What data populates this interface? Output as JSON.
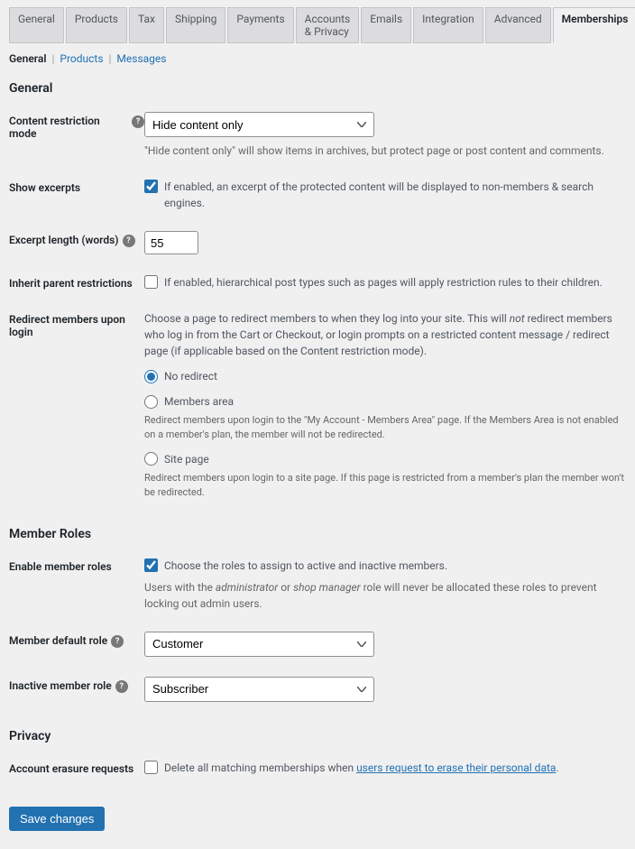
{
  "main_tabs": [
    "General",
    "Products",
    "Tax",
    "Shipping",
    "Payments",
    "Accounts & Privacy",
    "Emails",
    "Integration",
    "Advanced",
    "Memberships"
  ],
  "main_tab_active": 9,
  "sub_tabs": [
    "General",
    "Products",
    "Messages"
  ],
  "sub_tab_active": 0,
  "sections": {
    "general": "General",
    "member_roles": "Member Roles",
    "privacy": "Privacy"
  },
  "labels": {
    "content_restriction_mode": "Content restriction mode",
    "show_excerpts": "Show excerpts",
    "excerpt_length": "Excerpt length (words)",
    "inherit_parent": "Inherit parent restrictions",
    "redirect_members": "Redirect members upon login",
    "enable_member_roles": "Enable member roles",
    "member_default_role": "Member default role",
    "inactive_member_role": "Inactive member role",
    "account_erasure": "Account erasure requests"
  },
  "fields": {
    "content_restriction_mode": {
      "value": "Hide content only",
      "desc": "\"Hide content only\" will show items in archives, but protect page or post content and comments."
    },
    "show_excerpts": {
      "checked": true,
      "label": "If enabled, an excerpt of the protected content will be displayed to non-members & search engines."
    },
    "excerpt_length": {
      "value": "55"
    },
    "inherit_parent": {
      "checked": false,
      "label": "If enabled, hierarchical post types such as pages will apply restriction rules to their children."
    },
    "redirect_members": {
      "intro_1": "Choose a page to redirect members to when they log into your site. This will ",
      "intro_not": "not",
      "intro_2": " redirect members who log in from the Cart or Checkout, or login prompts on a restricted content message / redirect page (if applicable based on the Content restriction mode).",
      "selected": "no_redirect",
      "options": {
        "no_redirect": "No redirect",
        "members_area": "Members area",
        "site_page": "Site page"
      },
      "members_area_note": "Redirect members upon login to the \"My Account - Members Area\" page. If the Members Area is not enabled on a member's plan, the member will not be redirected.",
      "site_page_note": "Redirect members upon login to a site page. If this page is restricted from a member's plan the member won't be redirected."
    },
    "enable_member_roles": {
      "checked": true,
      "label": "Choose the roles to assign to active and inactive members.",
      "note_1": "Users with the ",
      "note_admin": "administrator",
      "note_or": " or ",
      "note_shop": "shop manager",
      "note_2": " role will never be allocated these roles to prevent locking out admin users."
    },
    "member_default_role": {
      "value": "Customer"
    },
    "inactive_member_role": {
      "value": "Subscriber"
    },
    "account_erasure": {
      "checked": false,
      "label_1": "Delete all matching memberships when ",
      "link": "users request to erase their personal data",
      "label_2": "."
    }
  },
  "save_button": "Save changes"
}
